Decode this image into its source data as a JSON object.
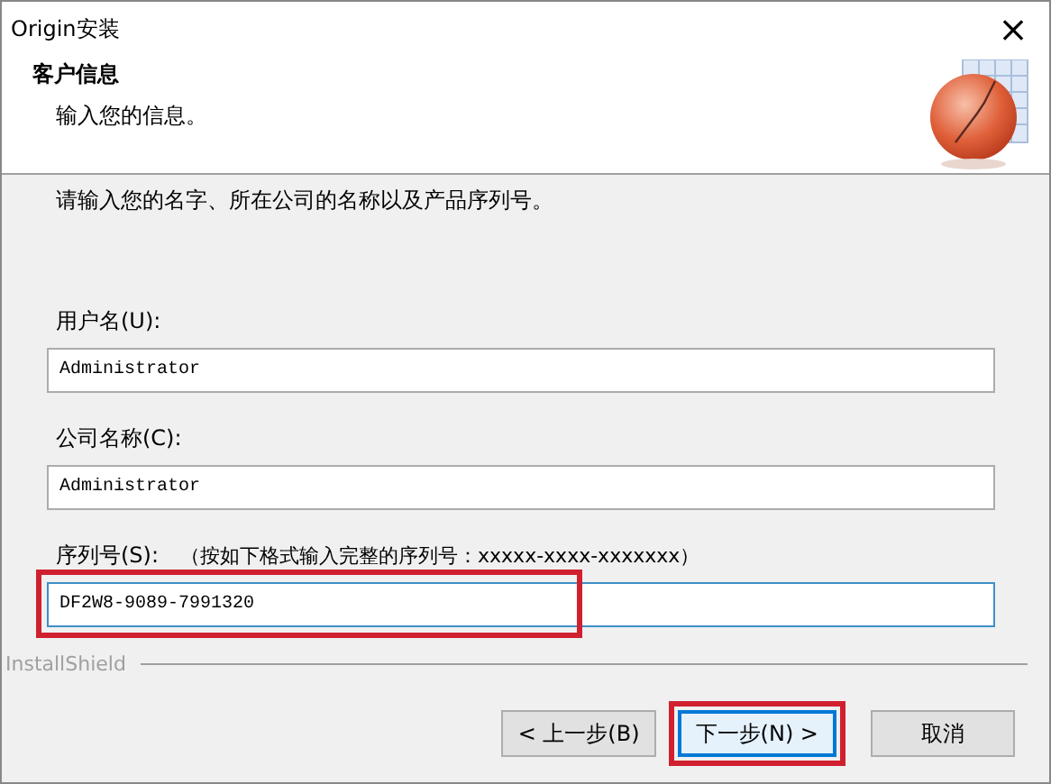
{
  "window": {
    "title": "Origin安装",
    "close": "×"
  },
  "header": {
    "title": "客户信息",
    "subtitle": "输入您的信息。"
  },
  "instruction": "请输入您的名字、所在公司的名称以及产品序列号。",
  "fields": [
    {
      "label": "用户名(U):",
      "value": "Administrator",
      "highlighted": false
    },
    {
      "label": "公司名称(C):",
      "value": "Administrator",
      "highlighted": false
    },
    {
      "label": "序列号(S):",
      "hint": "（按如下格式输入完整的序列号：xxxxx-xxxx-xxxxxxx）",
      "value": "DF2W8-9089-7991320",
      "highlighted": true
    }
  ],
  "brand": "InstallShield",
  "buttons": [
    {
      "label": "< 上一步(B)",
      "default": false,
      "highlighted": false
    },
    {
      "label": "下一步(N) >",
      "default": true,
      "highlighted": true
    },
    {
      "label": "取消",
      "default": false,
      "highlighted": false
    }
  ]
}
